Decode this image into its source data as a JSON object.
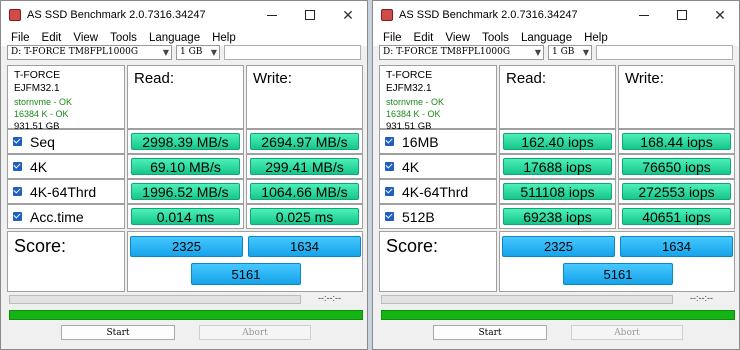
{
  "windows": [
    {
      "title": "AS SSD Benchmark 2.0.7316.34247",
      "menu": [
        "File",
        "Edit",
        "View",
        "Tools",
        "Language",
        "Help"
      ],
      "drive": "D: T-FORCE TM8FPL1000G",
      "size": "1 GB",
      "info": {
        "brand": "T-FORCE",
        "firmware": "EJFM32.1",
        "driver_status": "stornvme - OK",
        "alignment_status": "16384 K - OK",
        "capacity": "931.51 GB"
      },
      "headers": {
        "read": "Read:",
        "write": "Write:"
      },
      "rows": [
        {
          "label": "Seq",
          "read": "2998.39 MB/s",
          "write": "2694.97 MB/s"
        },
        {
          "label": "4K",
          "read": "69.10 MB/s",
          "write": "299.41 MB/s"
        },
        {
          "label": "4K-64Thrd",
          "read": "1996.52 MB/s",
          "write": "1064.66 MB/s"
        },
        {
          "label": "Acc.time",
          "read": "0.014 ms",
          "write": "0.025 ms"
        }
      ],
      "score": {
        "label": "Score:",
        "read": "2325",
        "write": "1634",
        "total": "5161"
      },
      "elapsed": "--:--:--",
      "buttons": {
        "start": "Start",
        "abort": "Abort"
      }
    },
    {
      "title": "AS SSD Benchmark 2.0.7316.34247",
      "menu": [
        "File",
        "Edit",
        "View",
        "Tools",
        "Language",
        "Help"
      ],
      "drive": "D: T-FORCE TM8FPL1000G",
      "size": "1 GB",
      "info": {
        "brand": "T-FORCE",
        "firmware": "EJFM32.1",
        "driver_status": "stornvme - OK",
        "alignment_status": "16384 K - OK",
        "capacity": "931.51 GB"
      },
      "headers": {
        "read": "Read:",
        "write": "Write:"
      },
      "rows": [
        {
          "label": "16MB",
          "read": "162.40 iops",
          "write": "168.44 iops"
        },
        {
          "label": "4K",
          "read": "17688 iops",
          "write": "76650 iops"
        },
        {
          "label": "4K-64Thrd",
          "read": "511108 iops",
          "write": "272553 iops"
        },
        {
          "label": "512B",
          "read": "69238 iops",
          "write": "40651 iops"
        }
      ],
      "score": {
        "label": "Score:",
        "read": "2325",
        "write": "1634",
        "total": "5161"
      },
      "elapsed": "--:--:--",
      "buttons": {
        "start": "Start",
        "abort": "Abort"
      }
    }
  ],
  "colors": {
    "result_green": "#2ee0a0",
    "score_blue": "#2bb6f5",
    "progress_green": "#14b414"
  },
  "icons": {
    "checkbox": "checkbox-checked-icon",
    "app": "as-ssd-app-icon"
  }
}
